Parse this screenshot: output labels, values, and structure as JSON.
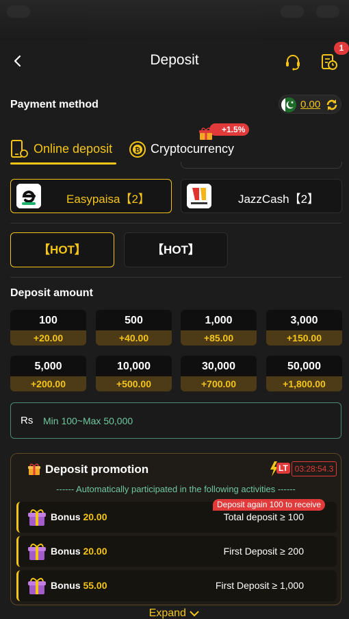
{
  "header": {
    "title": "Deposit",
    "notification_count": "1"
  },
  "payment": {
    "label": "Payment method",
    "balance": "0.00"
  },
  "tabs": [
    {
      "label": "Online deposit",
      "active": true
    },
    {
      "label": "Cryptocurrency",
      "active": false,
      "bonus": "+1.5%"
    }
  ],
  "methods": [
    {
      "label": "Easypaisa【2】",
      "active": true
    },
    {
      "label": "JazzCash【2】",
      "active": false
    }
  ],
  "channels": [
    {
      "label": "【HOT】",
      "active": true
    },
    {
      "label": "【HOT】",
      "active": false
    }
  ],
  "deposit": {
    "label": "Deposit amount",
    "amounts": [
      {
        "value": "100",
        "bonus": "+20.00"
      },
      {
        "value": "500",
        "bonus": "+40.00"
      },
      {
        "value": "1,000",
        "bonus": "+85.00"
      },
      {
        "value": "3,000",
        "bonus": "+150.00"
      },
      {
        "value": "5,000",
        "bonus": "+200.00"
      },
      {
        "value": "10,000",
        "bonus": "+500.00"
      },
      {
        "value": "30,000",
        "bonus": "+700.00"
      },
      {
        "value": "50,000",
        "bonus": "+1,800.00"
      }
    ],
    "currency": "Rs",
    "placeholder": "Min 100~Max 50,000"
  },
  "promotion": {
    "title": "Deposit promotion",
    "lt_label": "LT",
    "countdown": "03:28:54.3",
    "subtitle": "------ Automatically participated in the following activities ------",
    "tip": "Deposit again 100 to receive",
    "bonus_word": "Bonus",
    "rows": [
      {
        "amount": "20.00",
        "condition": "Total deposit ≥ 100"
      },
      {
        "amount": "20.00",
        "condition": "First Deposit ≥ 200"
      },
      {
        "amount": "55.00",
        "condition": "First Deposit ≥ 1,000"
      }
    ],
    "expand_label": "Expand"
  },
  "colors": {
    "accent": "#f5c518",
    "alert": "#e03a3a",
    "info": "#6fc7a0"
  }
}
